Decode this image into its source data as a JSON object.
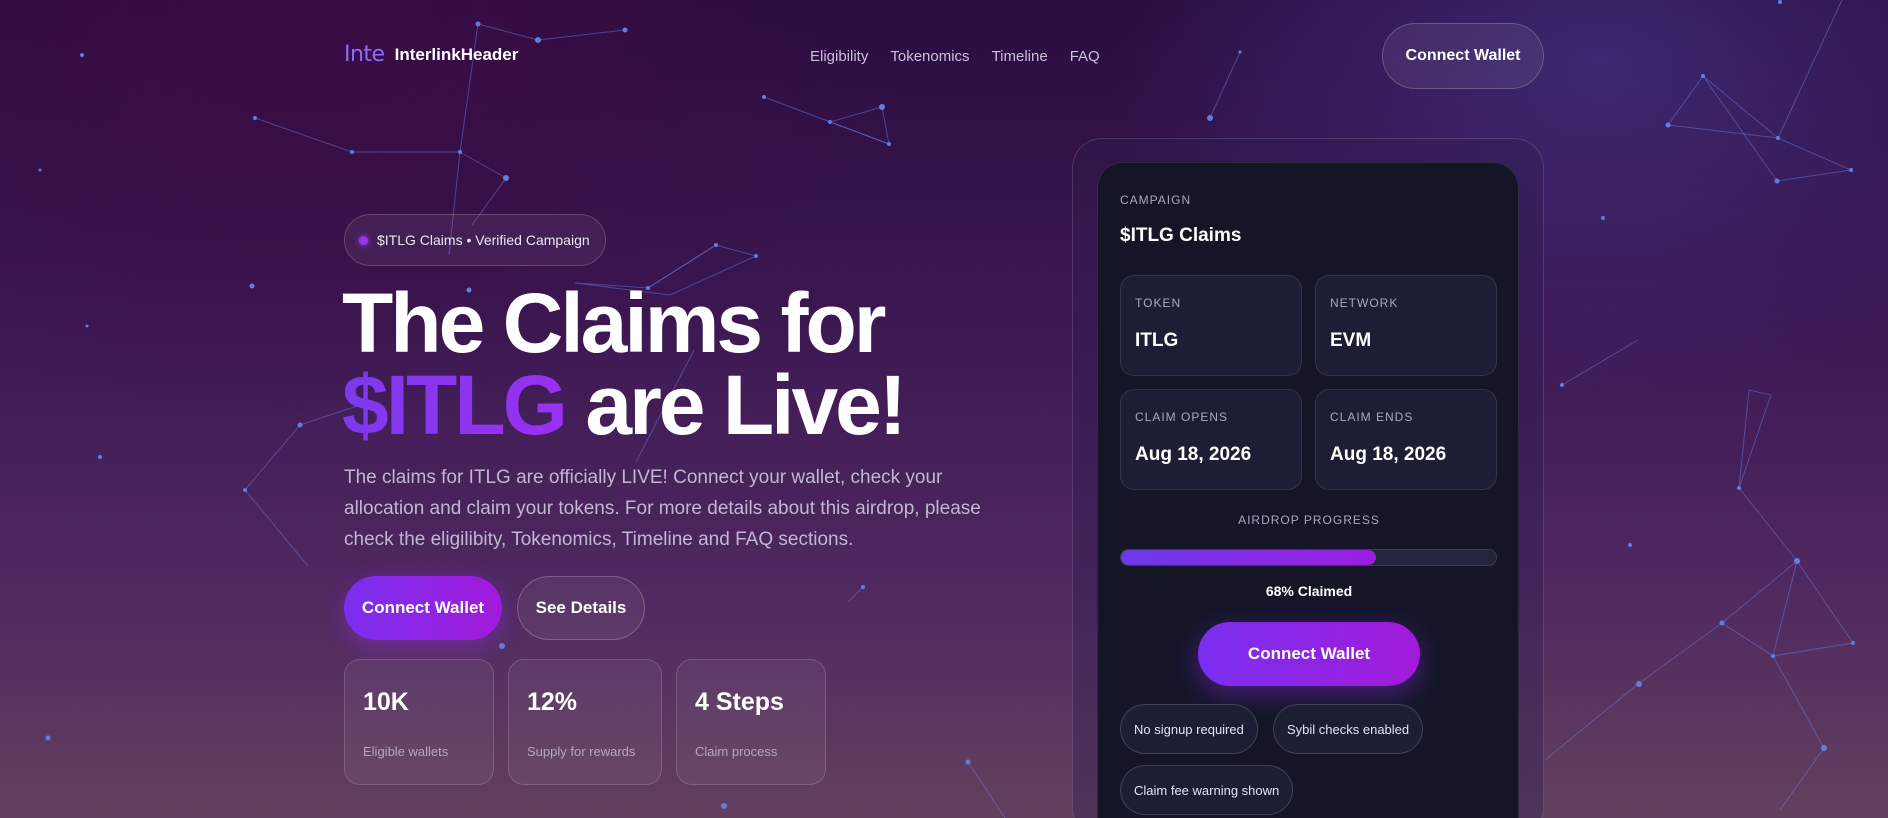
{
  "header": {
    "logo_mark": "Inte",
    "logo_text": "InterlinkHeader",
    "nav": [
      "Eligibility",
      "Tokenomics",
      "Timeline",
      "FAQ"
    ],
    "connect_label": "Connect Wallet"
  },
  "hero": {
    "badge": "$ITLG Claims • Verified Campaign",
    "title_line1": "The Claims for",
    "title_accent": "$ITLG",
    "title_line2_rest": " are Live!",
    "description": "The claims for ITLG are officially LIVE! Connect your wallet, check your allocation and claim your tokens. For more details about this airdrop, please check the eligilibity, Tokenomics, Timeline and FAQ sections.",
    "primary_button": "Connect Wallet",
    "secondary_button": "See Details",
    "stats": [
      {
        "value": "10K",
        "label": "Eligible wallets"
      },
      {
        "value": "12%",
        "label": "Supply for rewards"
      },
      {
        "value": "4 Steps",
        "label": "Claim process"
      }
    ]
  },
  "campaign": {
    "eyebrow": "CAMPAIGN",
    "title": "$ITLG Claims",
    "token_label": "TOKEN",
    "token_value": "ITLG",
    "network_label": "NETWORK",
    "network_value": "EVM",
    "opens_label": "CLAIM OPENS",
    "opens_value": "Aug 18, 2026",
    "ends_label": "CLAIM ENDS",
    "ends_value": "Aug 18, 2026",
    "progress_label": "AIRDROP PROGRESS",
    "progress_fraction": 0.68,
    "progress_text": "68% Claimed",
    "connect_label": "Connect Wallet",
    "pills": [
      "No signup required",
      "Sybil checks enabled",
      "Claim fee warning shown"
    ]
  },
  "colors": {
    "accent": "#7c3aed",
    "accent_end": "#a21ad9",
    "card_bg": "#141628",
    "network_dots": "#5f7fe0"
  }
}
